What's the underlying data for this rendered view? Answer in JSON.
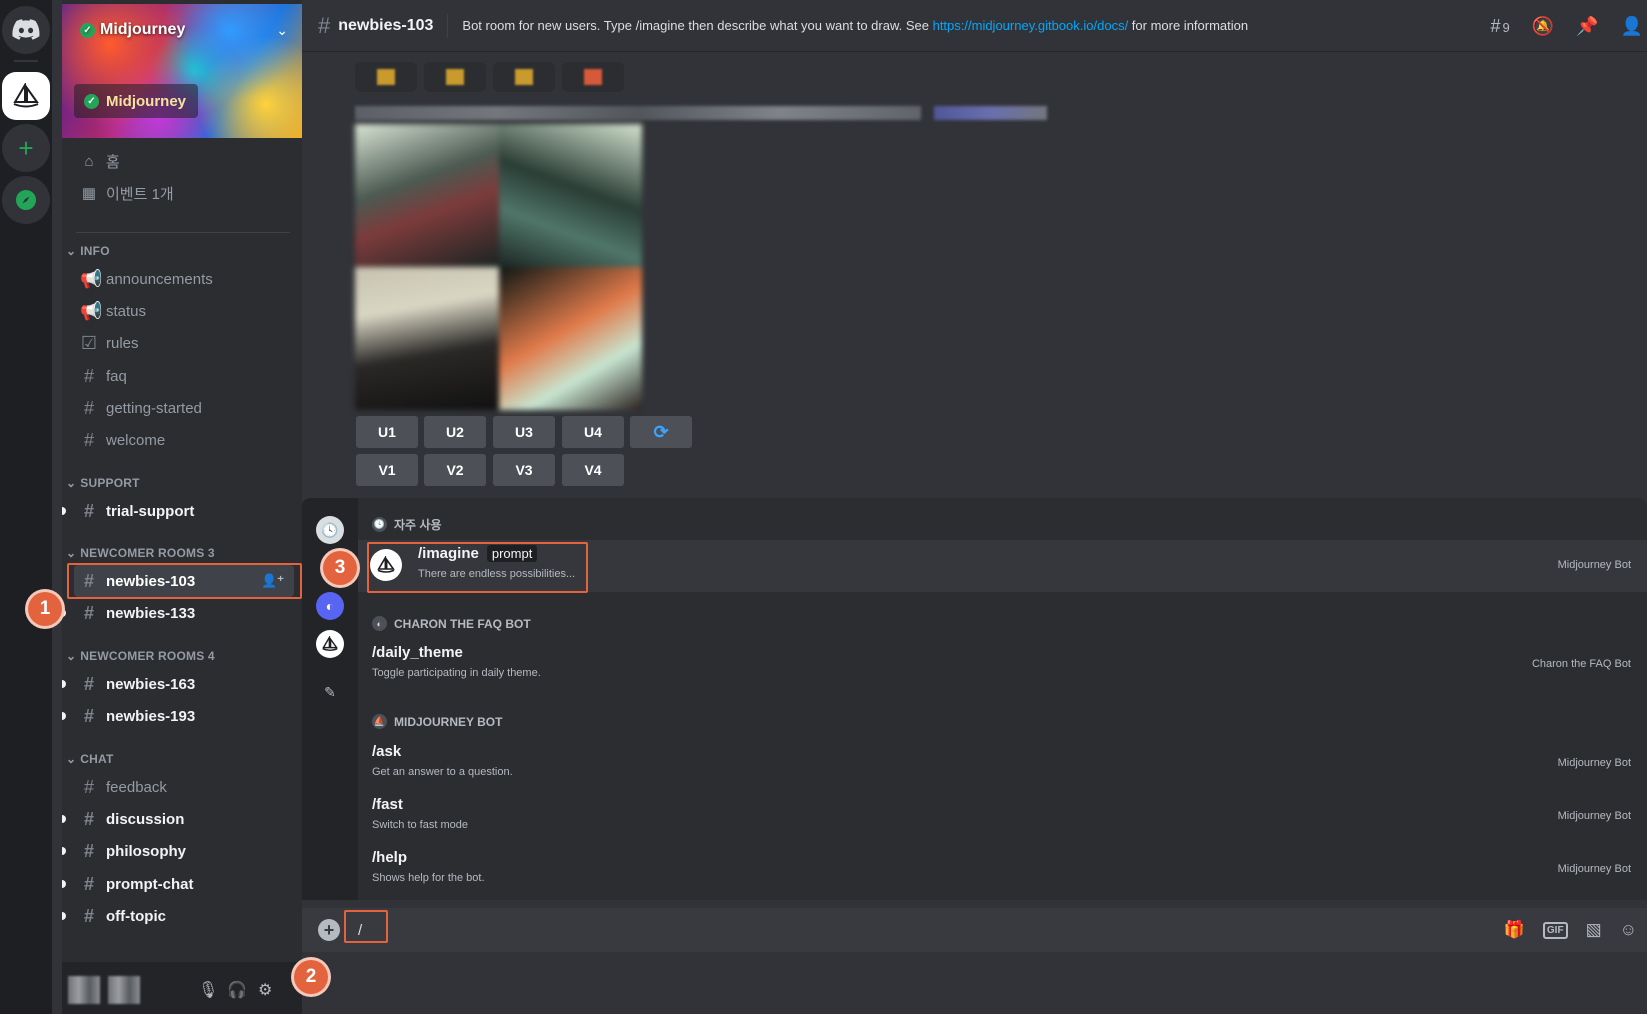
{
  "server": {
    "name": "Midjourney",
    "banner_badge": "Midjourney"
  },
  "sidebar": {
    "top_items": [
      {
        "label": "홈",
        "icon": "home-icon"
      },
      {
        "label": "이벤트 1개",
        "icon": "calendar-icon"
      }
    ],
    "categories": {
      "info": "INFO",
      "support": "SUPPORT",
      "newcomer3": "NEWCOMER ROOMS 3",
      "newcomer4": "NEWCOMER ROOMS 4",
      "chat": "CHAT"
    },
    "channels": {
      "announcements": "announcements",
      "status": "status",
      "rules": "rules",
      "faq": "faq",
      "getting_started": "getting-started",
      "welcome": "welcome",
      "trial_support": "trial-support",
      "newbies_103": "newbies-103",
      "newbies_133": "newbies-133",
      "newbies_163": "newbies-163",
      "newbies_193": "newbies-193",
      "feedback": "feedback",
      "discussion": "discussion",
      "philosophy": "philosophy",
      "prompt_chat": "prompt-chat",
      "off_topic": "off-topic"
    }
  },
  "header": {
    "channel": "newbies-103",
    "topic_prefix": "Bot room for new users. Type /imagine then describe what you want to draw. See ",
    "topic_link": "https://midjourney.gitbook.io/docs/",
    "topic_suffix": " for more information",
    "thread_count": "9"
  },
  "message": {
    "upscale_buttons": [
      "U1",
      "U2",
      "U3",
      "U4"
    ],
    "variation_buttons": [
      "V1",
      "V2",
      "V3",
      "V4"
    ]
  },
  "popup": {
    "frequent_header": "자주 사용",
    "imagine": {
      "name": "/imagine",
      "option": "prompt",
      "desc": "There are endless possibilities...",
      "source": "Midjourney Bot"
    },
    "charon_header": "CHARON THE FAQ BOT",
    "daily_theme": {
      "name": "/daily_theme",
      "desc": "Toggle participating in daily theme.",
      "source": "Charon the FAQ Bot"
    },
    "mj_header": "MIDJOURNEY BOT",
    "ask": {
      "name": "/ask",
      "desc": "Get an answer to a question.",
      "source": "Midjourney Bot"
    },
    "fast": {
      "name": "/fast",
      "desc": "Switch to fast mode",
      "source": "Midjourney Bot"
    },
    "help": {
      "name": "/help",
      "desc": "Shows help for the bot.",
      "source": "Midjourney Bot"
    }
  },
  "composer": {
    "value": "/"
  },
  "steps": {
    "one": "1",
    "two": "2",
    "three": "3"
  },
  "colors": {
    "accent": "#e4633f",
    "link": "#00a8fc",
    "online": "#23a559"
  }
}
